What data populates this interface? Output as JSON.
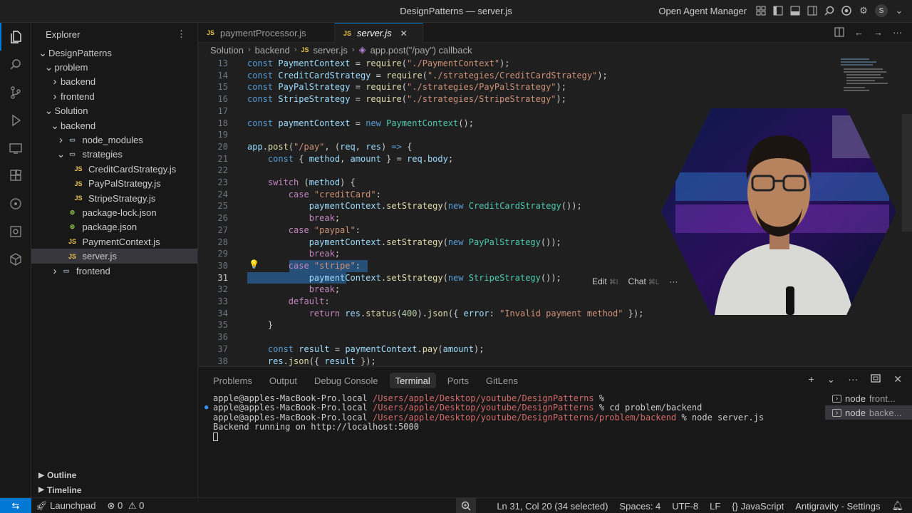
{
  "window": {
    "title": "DesignPatterns — server.js",
    "agent_manager": "Open Agent Manager",
    "avatar_letter": "S"
  },
  "sidebar": {
    "header": "Explorer",
    "tree": [
      {
        "label": "DesignPatterns",
        "indent": 0,
        "chev": "down",
        "icon": ""
      },
      {
        "label": "problem",
        "indent": 1,
        "chev": "down",
        "icon": ""
      },
      {
        "label": "backend",
        "indent": 2,
        "chev": "right",
        "icon": ""
      },
      {
        "label": "frontend",
        "indent": 2,
        "chev": "right",
        "icon": ""
      },
      {
        "label": "Solution",
        "indent": 1,
        "chev": "down",
        "icon": ""
      },
      {
        "label": "backend",
        "indent": 2,
        "chev": "down",
        "icon": ""
      },
      {
        "label": "node_modules",
        "indent": 3,
        "chev": "right",
        "icon": "folder"
      },
      {
        "label": "strategies",
        "indent": 3,
        "chev": "down",
        "icon": "folder"
      },
      {
        "label": "CreditCardStrategy.js",
        "indent": 4,
        "chev": "",
        "icon": "js"
      },
      {
        "label": "PayPalStrategy.js",
        "indent": 4,
        "chev": "",
        "icon": "js"
      },
      {
        "label": "StripeStrategy.js",
        "indent": 4,
        "chev": "",
        "icon": "js"
      },
      {
        "label": "package-lock.json",
        "indent": 3,
        "chev": "",
        "icon": "json"
      },
      {
        "label": "package.json",
        "indent": 3,
        "chev": "",
        "icon": "json"
      },
      {
        "label": "PaymentContext.js",
        "indent": 3,
        "chev": "",
        "icon": "js"
      },
      {
        "label": "server.js",
        "indent": 3,
        "chev": "",
        "icon": "js",
        "selected": true
      },
      {
        "label": "frontend",
        "indent": 2,
        "chev": "right",
        "icon": "folder"
      }
    ],
    "outline": "Outline",
    "timeline": "Timeline"
  },
  "tabs": [
    {
      "label": "paymentProcessor.js",
      "active": false
    },
    {
      "label": "server.js",
      "active": true
    }
  ],
  "breadcrumb": [
    "Solution",
    "backend",
    "server.js",
    "app.post(\"/pay\") callback"
  ],
  "editor": {
    "lines": [
      {
        "n": "13",
        "tokens": [
          [
            "kw",
            "const "
          ],
          [
            "var",
            "PaymentContext"
          ],
          [
            "",
            " = "
          ],
          [
            "fn",
            "require"
          ],
          [
            "",
            "("
          ],
          [
            "str",
            "\"./PaymentContext\""
          ],
          [
            "",
            ");"
          ]
        ]
      },
      {
        "n": "14",
        "tokens": [
          [
            "kw",
            "const "
          ],
          [
            "var",
            "CreditCardStrategy"
          ],
          [
            "",
            " = "
          ],
          [
            "fn",
            "require"
          ],
          [
            "",
            "("
          ],
          [
            "str",
            "\"./strategies/CreditCardStrategy\""
          ],
          [
            "",
            ");"
          ]
        ]
      },
      {
        "n": "15",
        "tokens": [
          [
            "kw",
            "const "
          ],
          [
            "var",
            "PayPalStrategy"
          ],
          [
            "",
            " = "
          ],
          [
            "fn",
            "require"
          ],
          [
            "",
            "("
          ],
          [
            "str",
            "\"./strategies/PayPalStrategy\""
          ],
          [
            "",
            ");"
          ]
        ]
      },
      {
        "n": "16",
        "tokens": [
          [
            "kw",
            "const "
          ],
          [
            "var",
            "StripeStrategy"
          ],
          [
            "",
            " = "
          ],
          [
            "fn",
            "require"
          ],
          [
            "",
            "("
          ],
          [
            "str",
            "\"./strategies/StripeStrategy\""
          ],
          [
            "",
            ");"
          ]
        ]
      },
      {
        "n": "17",
        "tokens": []
      },
      {
        "n": "18",
        "tokens": [
          [
            "kw",
            "const "
          ],
          [
            "var",
            "paymentContext"
          ],
          [
            "",
            " = "
          ],
          [
            "kw",
            "new "
          ],
          [
            "cls",
            "PaymentContext"
          ],
          [
            "",
            "();"
          ]
        ]
      },
      {
        "n": "19",
        "tokens": []
      },
      {
        "n": "20",
        "tokens": [
          [
            "var",
            "app"
          ],
          [
            "",
            "."
          ],
          [
            "fn",
            "post"
          ],
          [
            "",
            "("
          ],
          [
            "str",
            "\"/pay\""
          ],
          [
            "",
            ", ("
          ],
          [
            "var",
            "req"
          ],
          [
            "",
            ", "
          ],
          [
            "var",
            "res"
          ],
          [
            "",
            ") "
          ],
          [
            "kw",
            "=>"
          ],
          [
            "",
            " {"
          ]
        ]
      },
      {
        "n": "21",
        "tokens": [
          [
            "",
            "    "
          ],
          [
            "kw",
            "const "
          ],
          [
            "",
            "{ "
          ],
          [
            "var",
            "method"
          ],
          [
            "",
            ", "
          ],
          [
            "var",
            "amount"
          ],
          [
            "",
            " } = "
          ],
          [
            "var",
            "req"
          ],
          [
            "",
            "."
          ],
          [
            "var",
            "body"
          ],
          [
            "",
            ";"
          ]
        ]
      },
      {
        "n": "22",
        "tokens": []
      },
      {
        "n": "23",
        "tokens": [
          [
            "",
            "    "
          ],
          [
            "ctl",
            "switch"
          ],
          [
            "",
            " ("
          ],
          [
            "var",
            "method"
          ],
          [
            "",
            ") {"
          ]
        ]
      },
      {
        "n": "24",
        "tokens": [
          [
            "",
            "        "
          ],
          [
            "ctl",
            "case "
          ],
          [
            "str",
            "\"creditCard\""
          ],
          [
            "",
            ":"
          ]
        ]
      },
      {
        "n": "25",
        "tokens": [
          [
            "",
            "            "
          ],
          [
            "var",
            "paymentContext"
          ],
          [
            "",
            "."
          ],
          [
            "fn",
            "setStrategy"
          ],
          [
            "",
            "("
          ],
          [
            "kw",
            "new "
          ],
          [
            "cls",
            "CreditCardStrategy"
          ],
          [
            "",
            "());"
          ]
        ]
      },
      {
        "n": "26",
        "tokens": [
          [
            "",
            "            "
          ],
          [
            "ctl",
            "break"
          ],
          [
            "",
            ";"
          ]
        ]
      },
      {
        "n": "27",
        "tokens": [
          [
            "",
            "        "
          ],
          [
            "ctl",
            "case "
          ],
          [
            "str",
            "\"paypal\""
          ],
          [
            "",
            ":"
          ]
        ]
      },
      {
        "n": "28",
        "tokens": [
          [
            "",
            "            "
          ],
          [
            "var",
            "paymentContext"
          ],
          [
            "",
            "."
          ],
          [
            "fn",
            "setStrategy"
          ],
          [
            "",
            "("
          ],
          [
            "kw",
            "new "
          ],
          [
            "cls",
            "PayPalStrategy"
          ],
          [
            "",
            "());"
          ]
        ]
      },
      {
        "n": "29",
        "tokens": [
          [
            "",
            "            "
          ],
          [
            "ctl",
            "break"
          ],
          [
            "",
            ";"
          ]
        ]
      },
      {
        "n": "30",
        "tokens": [
          [
            "",
            "        "
          ],
          [
            "ctl",
            "case "
          ],
          [
            "str",
            "\"stripe\""
          ],
          [
            "",
            ":"
          ]
        ]
      },
      {
        "n": "31",
        "tokens": [
          [
            "",
            "            "
          ],
          [
            "var",
            "paymentContext"
          ],
          [
            "",
            "."
          ],
          [
            "fn",
            "setStrategy"
          ],
          [
            "",
            "("
          ],
          [
            "kw",
            "new "
          ],
          [
            "cls",
            "StripeStrategy"
          ],
          [
            "",
            "());"
          ]
        ]
      },
      {
        "n": "32",
        "tokens": [
          [
            "",
            "            "
          ],
          [
            "ctl",
            "break"
          ],
          [
            "",
            ";"
          ]
        ]
      },
      {
        "n": "33",
        "tokens": [
          [
            "",
            "        "
          ],
          [
            "ctl",
            "default"
          ],
          [
            "",
            ":"
          ]
        ]
      },
      {
        "n": "34",
        "tokens": [
          [
            "",
            "            "
          ],
          [
            "ctl",
            "return "
          ],
          [
            "var",
            "res"
          ],
          [
            "",
            "."
          ],
          [
            "fn",
            "status"
          ],
          [
            "",
            "("
          ],
          [
            "num",
            "400"
          ],
          [
            "",
            ")."
          ],
          [
            "fn",
            "json"
          ],
          [
            "",
            "({ "
          ],
          [
            "var",
            "error"
          ],
          [
            "",
            ": "
          ],
          [
            "str",
            "\"Invalid payment method\""
          ],
          [
            "",
            " });"
          ]
        ]
      },
      {
        "n": "35",
        "tokens": [
          [
            "",
            "    }"
          ]
        ]
      },
      {
        "n": "36",
        "tokens": []
      },
      {
        "n": "37",
        "tokens": [
          [
            "",
            "    "
          ],
          [
            "kw",
            "const "
          ],
          [
            "var",
            "result"
          ],
          [
            "",
            " = "
          ],
          [
            "var",
            "paymentContext"
          ],
          [
            "",
            "."
          ],
          [
            "fn",
            "pay"
          ],
          [
            "",
            "("
          ],
          [
            "var",
            "amount"
          ],
          [
            "",
            ");"
          ]
        ]
      },
      {
        "n": "38",
        "tokens": [
          [
            "",
            "    "
          ],
          [
            "var",
            "res"
          ],
          [
            "",
            "."
          ],
          [
            "fn",
            "json"
          ],
          [
            "",
            "({ "
          ],
          [
            "var",
            "result"
          ],
          [
            "",
            " });"
          ]
        ]
      }
    ],
    "inline_edit": "Edit",
    "inline_edit_key": "⌘I",
    "inline_chat": "Chat",
    "inline_chat_key": "⌘L",
    "inline_more": "···"
  },
  "panel": {
    "tabs": [
      "Problems",
      "Output",
      "Debug Console",
      "Terminal",
      "Ports",
      "GitLens"
    ],
    "active_tab": "Terminal",
    "terminal": [
      {
        "host": "apple@apples-MacBook-Pro.local ",
        "path": "/Users/apple/Desktop/youtube/DesignPatterns",
        "cmd": " %",
        "dot": false
      },
      {
        "host": "apple@apples-MacBook-Pro.local ",
        "path": "/Users/apple/Desktop/youtube/DesignPatterns",
        "cmd": " % cd problem/backend",
        "dot": true
      },
      {
        "host": "apple@apples-MacBook-Pro.local ",
        "path": "/Users/apple/Desktop/youtube/DesignPatterns/problem/backend",
        "cmd": " % node server.js",
        "dot": false
      },
      {
        "host": "Backend running on http://localhost:5000",
        "path": "",
        "cmd": "",
        "dot": false
      }
    ],
    "terminal_list": [
      {
        "name": "node",
        "sub": "front...",
        "active": false
      },
      {
        "name": "node",
        "sub": "backe...",
        "active": true
      }
    ]
  },
  "statusbar": {
    "launchpad": "Launchpad",
    "errors": "0",
    "warnings": "0",
    "position": "Ln 31, Col 20 (34 selected)",
    "spaces": "Spaces: 4",
    "encoding": "UTF-8",
    "eol": "LF",
    "language": "JavaScript",
    "settings": "Antigravity - Settings"
  },
  "colors": {
    "accent": "#0078d4",
    "selection": "#264f78"
  }
}
